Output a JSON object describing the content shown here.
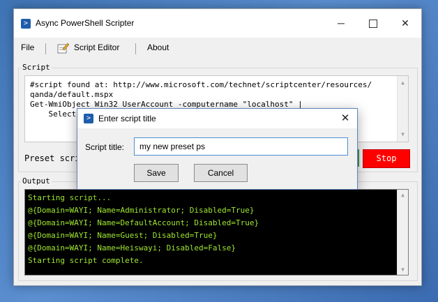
{
  "window": {
    "title": "Async PowerShell Scripter",
    "icon": "powershell-icon",
    "controls": {
      "minimize": "─",
      "close": "✕"
    }
  },
  "menu": {
    "file": "File",
    "script_editor": "Script Editor",
    "about": "About"
  },
  "script_group": {
    "label": "Script",
    "lines": [
      "#script found at: http://www.microsoft.com/technet/scriptcenter/resources/",
      "qanda/default.mspx",
      "Get-WmiObject Win32_UserAccount -computername \"localhost\" |",
      "    Select"
    ]
  },
  "controls_row": {
    "preset_label": "Preset scri",
    "stop_label": "Stop",
    "stop_color": "#ff0000"
  },
  "output_group": {
    "label": "Output",
    "text_color": "#9fe830",
    "lines": [
      "Starting script...",
      "@{Domain=WAYI; Name=Administrator; Disabled=True}",
      "@{Domain=WAYI; Name=DefaultAccount; Disabled=True}",
      "@{Domain=WAYI; Name=Guest; Disabled=True}",
      "@{Domain=WAYI; Name=Heiswayi; Disabled=False}",
      "Starting script complete."
    ]
  },
  "dialog": {
    "title": "Enter script title",
    "field_label": "Script title:",
    "field_value": "my new preset ps",
    "save_label": "Save",
    "cancel_label": "Cancel",
    "close_glyph": "✕"
  }
}
